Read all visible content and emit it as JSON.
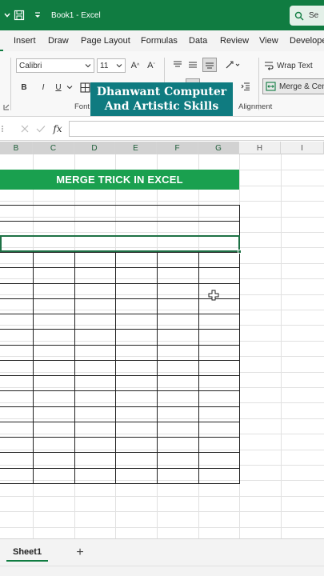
{
  "titlebar": {
    "doc_title": "Book1  -  Excel",
    "search_label": "Se",
    "save_icon": "save-icon",
    "qat_icon": "customize-qat-icon"
  },
  "tabs": [
    "Insert",
    "Draw",
    "Page Layout",
    "Formulas",
    "Data",
    "Review",
    "View",
    "Develope"
  ],
  "ribbon": {
    "font_name": "Calibri",
    "font_size": "11",
    "wrap_text": "Wrap Text",
    "merge_center": "Merge & Cent",
    "bold": "B",
    "italic": "I",
    "underline": "U",
    "font_group_label": "Font",
    "alignment_group_label": "Alignment",
    "grow_font": "A^",
    "shrink_font": "Aˇ"
  },
  "banner": {
    "line1": "Dhanwant Computer",
    "line2": "And Artistic Skills"
  },
  "formula_bar": {
    "fx_label": "fx",
    "value": ""
  },
  "columns": [
    "B",
    "C",
    "D",
    "E",
    "F",
    "G",
    "H",
    "I"
  ],
  "sheet": {
    "merged_title": "MERGE TRICK IN EXCEL"
  },
  "sheets": [
    "Sheet1"
  ],
  "colors": {
    "excel_green": "#107c41",
    "title_fill": "#1aa04f",
    "banner": "#0f7b80"
  }
}
